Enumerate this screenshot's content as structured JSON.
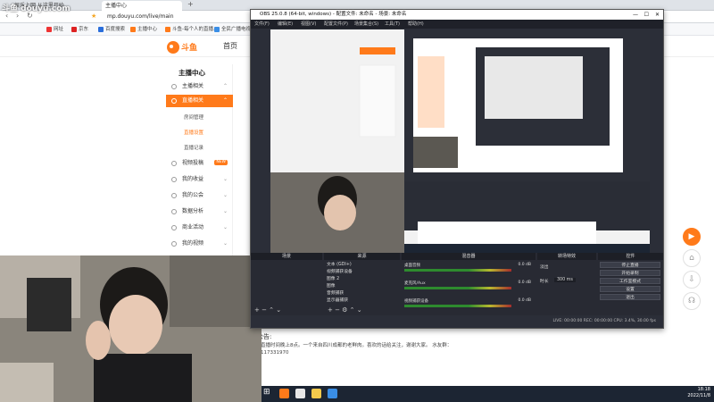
{
  "browser": {
    "tabs": [
      "娱乐上网 从这里开始",
      "主播中心"
    ],
    "url": "mp.douyu.com/live/main",
    "bookmarks": [
      "网址",
      "京东",
      "百度搜索",
      "主播中心",
      "斗鱼-每个人的直播...",
      "全民广播电视..."
    ]
  },
  "site": {
    "home_label": "首页",
    "sidebar_title": "主播中心",
    "items": [
      {
        "label": "主播相关",
        "active": false
      },
      {
        "label": "直播相关",
        "active": true
      },
      {
        "label": "视频投稿",
        "active": false,
        "badge": "NEW"
      },
      {
        "label": "我的收益",
        "active": false
      },
      {
        "label": "我的公会",
        "active": false
      },
      {
        "label": "数据分析",
        "active": false
      },
      {
        "label": "商业活动",
        "active": false
      },
      {
        "label": "我的视频",
        "active": false
      }
    ],
    "subitems": [
      "房间管理",
      "直播设置",
      "直播记录"
    ],
    "announcement_label": "公告:",
    "announcement": "直播时间晚上8点。一个来自四川成都的老鲜肉。喜欢的话给关注，谢谢大家。 水友群：117331970"
  },
  "obs": {
    "title": "OBS 25.0.8 (64-bit, windows) - 配置文件: 未命名 - 场景: 未命名",
    "menu": [
      "文件(F)",
      "编辑(E)",
      "视图(V)",
      "配置文件(P)",
      "场景集合(S)",
      "工具(T)",
      "帮助(H)"
    ],
    "docks": [
      "场景",
      "来源",
      "混音器",
      "转场特效",
      "控件"
    ],
    "sources": [
      "文本 (GDI+)",
      "视频捕获设备",
      "图像 2",
      "图像",
      "音频捕获",
      "显示器捕获"
    ],
    "mixer": [
      {
        "name": "桌面音频",
        "db": "0.0 dB"
      },
      {
        "name": "麦克风/Aux",
        "db": "0.0 dB"
      },
      {
        "name": "视频捕获设备",
        "db": "0.0 dB"
      }
    ],
    "transition": "淡出",
    "duration_label": "时长",
    "duration": "300 ms",
    "controls": [
      "停止直播",
      "开始录制",
      "工作室模式",
      "设置",
      "退出"
    ],
    "status": "LIVE: 00:00:00   REC: 00:00:00   CPU: 3.4%, 30.00 fps"
  },
  "taskbar": {
    "time": "18:18",
    "date": "2022/11/8"
  },
  "watermark": "斗鱼 douyu.com"
}
